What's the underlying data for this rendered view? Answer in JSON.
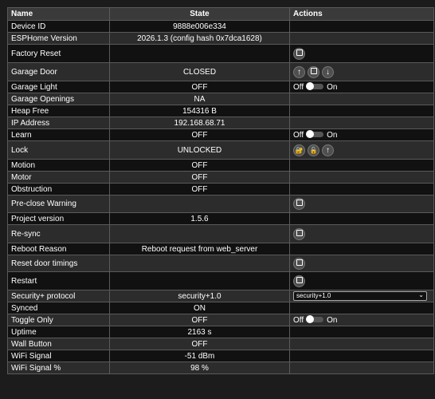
{
  "headers": {
    "name": "Name",
    "state": "State",
    "actions": "Actions"
  },
  "rows": [
    {
      "name": "Device ID",
      "state": "9888e006e334"
    },
    {
      "name": "ESPHome Version",
      "state": "2026.1.3 (config hash 0x7dca1628)"
    },
    {
      "name": "Factory Reset",
      "state": ""
    },
    {
      "name": "Garage Door",
      "state": "CLOSED"
    },
    {
      "name": "Garage Light",
      "state": "OFF"
    },
    {
      "name": "Garage Openings",
      "state": "NA"
    },
    {
      "name": "Heap Free",
      "state": "154316 B"
    },
    {
      "name": "IP Address",
      "state": "192.168.68.71"
    },
    {
      "name": "Learn",
      "state": "OFF"
    },
    {
      "name": "Lock",
      "state": "UNLOCKED"
    },
    {
      "name": "Motion",
      "state": "OFF"
    },
    {
      "name": "Motor",
      "state": "OFF"
    },
    {
      "name": "Obstruction",
      "state": "OFF"
    },
    {
      "name": "Pre-close Warning",
      "state": ""
    },
    {
      "name": "Project version",
      "state": "1.5.6"
    },
    {
      "name": "Re-sync",
      "state": ""
    },
    {
      "name": "Reboot Reason",
      "state": "Reboot request from web_server"
    },
    {
      "name": "Reset door timings",
      "state": ""
    },
    {
      "name": "Restart",
      "state": ""
    },
    {
      "name": "Security+ protocol",
      "state": "security+1.0"
    },
    {
      "name": "Synced",
      "state": "ON"
    },
    {
      "name": "Toggle Only",
      "state": "OFF"
    },
    {
      "name": "Uptime",
      "state": "2163 s"
    },
    {
      "name": "Wall Button",
      "state": "OFF"
    },
    {
      "name": "WiFi Signal",
      "state": "-51 dBm"
    },
    {
      "name": "WiFi Signal %",
      "state": "98 %"
    }
  ],
  "toggle": {
    "off_label": "Off",
    "on_label": "On"
  },
  "security_select": {
    "selected": "security+1.0"
  },
  "icons": {
    "press": "stop-square-icon",
    "open": "arrow-up-icon",
    "stop": "stop-square-icon",
    "close": "arrow-down-icon",
    "lock": "lock-closed-icon",
    "unlock": "lock-open-icon",
    "lock_open": "arrow-up-icon",
    "select_chevron": "chevron-down-icon"
  }
}
